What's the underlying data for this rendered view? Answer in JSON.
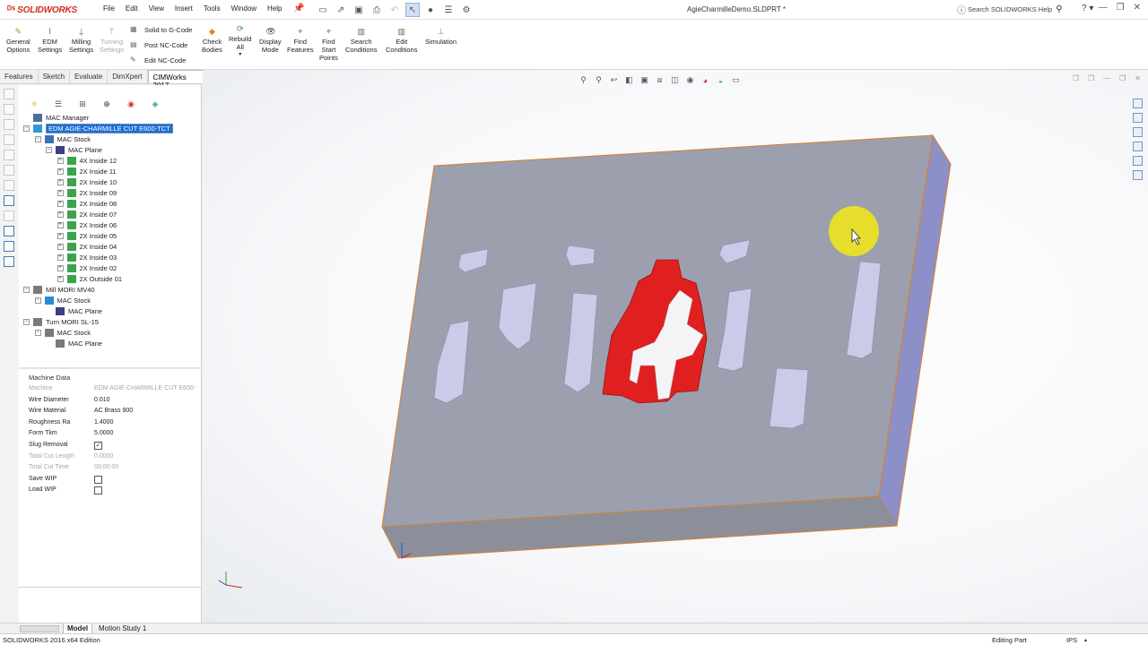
{
  "app": {
    "name": "SOLIDWORKS",
    "document_title": "AgieCharmilleDemo.SLDPRT *",
    "help_search_placeholder": "Search SOLIDWORKS Help"
  },
  "menu": [
    "File",
    "Edit",
    "View",
    "Insert",
    "Tools",
    "Window",
    "Help"
  ],
  "ribbon": {
    "general_options": "General\nOptions",
    "edm_settings": "EDM\nSettings",
    "milling_settings": "Milling\nSettings",
    "turning_settings": "Turning\nSettings",
    "solid_to_gcode": "Solid to G-Code",
    "post_nc_code": "Post NC-Code",
    "edit_nc_code": "Edit NC-Code",
    "check_bodies": "Check\nBodies",
    "rebuild_all": "Rebuild\nAll",
    "display_mode": "Display\nMode",
    "find_features": "Find\nFeatures",
    "find_start_points": "Find\nStart\nPoints",
    "search_conditions": "Search\nConditions",
    "edit_conditions": "Edit\nConditions",
    "simulation": "Simulation"
  },
  "tabs": [
    "Features",
    "Sketch",
    "Evaluate",
    "DimXpert",
    "CIMWorks 2017"
  ],
  "active_tab": "CIMWorks 2017",
  "tree": [
    {
      "label": "MAC Manager",
      "level": 0,
      "expander": "",
      "icon": "#4a6f9a"
    },
    {
      "label": "EDM AGIE-CHARMILLE CUT E600-TCT",
      "level": 0,
      "expander": "−",
      "icon": "#2a9bd7",
      "selected": true
    },
    {
      "label": "MAC Stock",
      "level": 1,
      "expander": "−",
      "icon": "#3b6fb6"
    },
    {
      "label": "MAC Plane",
      "level": 2,
      "expander": "−",
      "icon": "#3a3f86"
    },
    {
      "label": "4X Inside 12",
      "level": 3,
      "expander": "+",
      "icon": "#3ba34a"
    },
    {
      "label": "2X Inside 11",
      "level": 3,
      "expander": "+",
      "icon": "#3ba34a"
    },
    {
      "label": "2X Inside 10",
      "level": 3,
      "expander": "+",
      "icon": "#3ba34a"
    },
    {
      "label": "2X Inside 09",
      "level": 3,
      "expander": "+",
      "icon": "#3ba34a"
    },
    {
      "label": "2X Inside 08",
      "level": 3,
      "expander": "+",
      "icon": "#3ba34a"
    },
    {
      "label": "2X Inside 07",
      "level": 3,
      "expander": "+",
      "icon": "#3ba34a"
    },
    {
      "label": "2X Inside 06",
      "level": 3,
      "expander": "+",
      "icon": "#3ba34a"
    },
    {
      "label": "2X Inside 05",
      "level": 3,
      "expander": "+",
      "icon": "#3ba34a"
    },
    {
      "label": "2X Inside 04",
      "level": 3,
      "expander": "+",
      "icon": "#3ba34a"
    },
    {
      "label": "2X Inside 03",
      "level": 3,
      "expander": "+",
      "icon": "#3ba34a"
    },
    {
      "label": "2X Inside 02",
      "level": 3,
      "expander": "+",
      "icon": "#3ba34a"
    },
    {
      "label": "2X Outside 01",
      "level": 3,
      "expander": "+",
      "icon": "#3ba34a"
    },
    {
      "label": "Mill MORI MV40",
      "level": 0,
      "expander": "−",
      "icon": "#7a7a7a"
    },
    {
      "label": "MAC Stock",
      "level": 1,
      "expander": "−",
      "icon": "#2a8bd7"
    },
    {
      "label": "MAC Plane",
      "level": 2,
      "expander": "",
      "icon": "#3a3f86"
    },
    {
      "label": "Turn MORI SL-15",
      "level": 0,
      "expander": "−",
      "icon": "#7a7a7a"
    },
    {
      "label": "MAC Stock",
      "level": 1,
      "expander": "−",
      "icon": "#7a7a7a"
    },
    {
      "label": "MAC Plane",
      "level": 2,
      "expander": "",
      "icon": "#7a7a7a"
    }
  ],
  "machine_data": {
    "title": "Machine Data",
    "rows": [
      {
        "label": "Machine",
        "value": "EDM AGIE-CHARMILLE CUT E600-",
        "dim": true
      },
      {
        "label": "Wire Diameter",
        "value": "0.010"
      },
      {
        "label": "Wire Material",
        "value": "AC Brass 900"
      },
      {
        "label": "Roughness Ra",
        "value": "1.4000"
      },
      {
        "label": "Form Tkm",
        "value": "5.0000"
      },
      {
        "label": "Slug Removal",
        "checkbox": true,
        "checked": true
      },
      {
        "label": "Total Cut Length",
        "value": "0.0000",
        "dim": true
      },
      {
        "label": "Total Cut Time",
        "value": "00:00:00",
        "dim": true
      },
      {
        "label": "Save WIP",
        "checkbox": true,
        "checked": false
      },
      {
        "label": "Load WIP",
        "checkbox": true,
        "checked": false
      }
    ]
  },
  "bottom_tabs": [
    "Model",
    "Motion Study 1"
  ],
  "status": {
    "edition": "SOLIDWORKS 2016 x64 Edition",
    "mode": "Editing Part",
    "units": "IPS"
  },
  "colors": {
    "plate_top": "#9c9fae",
    "plate_side": "#8d90c8",
    "edge_orange": "#d8812a",
    "pocket_face": "#c9cbe8",
    "highlight_red": "#e02020",
    "cursor_halo": "#f3e816"
  }
}
